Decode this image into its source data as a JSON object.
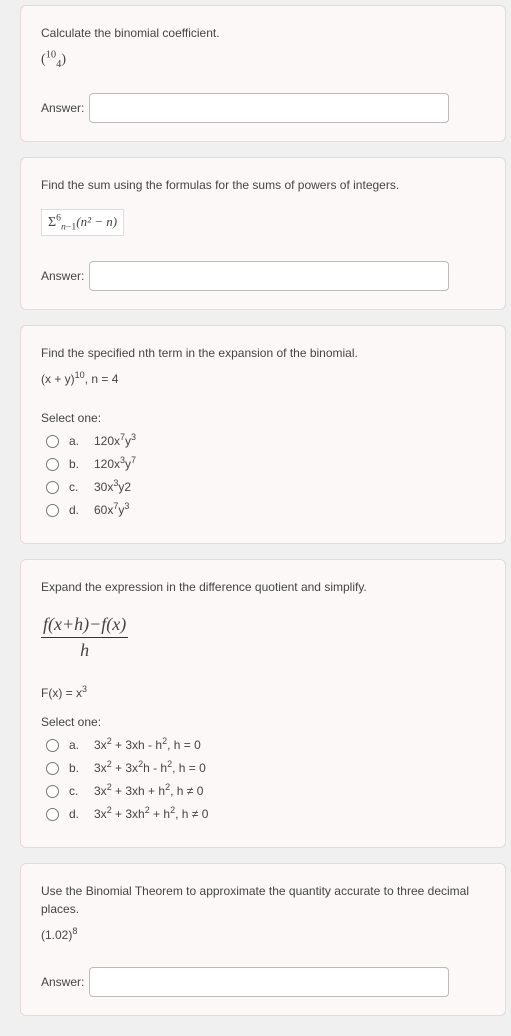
{
  "q1": {
    "prompt": "Calculate the binomial coefficient.",
    "expr_base_open": "(",
    "expr_sup": "10",
    "expr_sub": "4",
    "expr_close": ")",
    "answer_label": "Answer:"
  },
  "q2": {
    "prompt": "Find the sum using the formulas for the sums of powers of integers.",
    "sigma": "Σ",
    "sigma_top": "6",
    "sigma_bottom_pre": "n",
    "sigma_bottom_post": "−1",
    "body": "(n² − n)",
    "answer_label": "Answer:"
  },
  "q3": {
    "prompt": "Find the specified nth term in the expansion of the binomial.",
    "expr_pre": "(x + y)",
    "expr_sup": "10",
    "expr_post": ", n = 4",
    "select_label": "Select one:",
    "opt_a_letter": "a.",
    "opt_a_pre": "120x",
    "opt_a_sup1": "7",
    "opt_a_mid": "y",
    "opt_a_sup2": "3",
    "opt_b_letter": "b.",
    "opt_b_pre": "120x",
    "opt_b_sup1": "3",
    "opt_b_mid": "y",
    "opt_b_sup2": "7",
    "opt_c_letter": "c.",
    "opt_c_pre": "30x",
    "opt_c_sup1": "3",
    "opt_c_mid": "y2",
    "opt_d_letter": "d.",
    "opt_d_pre": "60x",
    "opt_d_sup1": "7",
    "opt_d_mid": "y",
    "opt_d_sup2": "3"
  },
  "q4": {
    "prompt": "Expand the expression in the difference quotient and simplify.",
    "num": "f(x+h)−f(x)",
    "den": "h",
    "fx_pre": "F(x) = x",
    "fx_sup": "3",
    "select_label": "Select one:",
    "opt_a_letter": "a.",
    "opt_a_p1": "3x",
    "opt_a_s1": "2",
    "opt_a_p2": " + 3xh - h",
    "opt_a_s2": "2",
    "opt_a_p3": ", h = 0",
    "opt_b_letter": "b.",
    "opt_b_p1": "3x",
    "opt_b_s1": "2",
    "opt_b_p2": " + 3x",
    "opt_b_s2": "2",
    "opt_b_p3": "h - h",
    "opt_b_s3": "2",
    "opt_b_p4": ", h = 0",
    "opt_c_letter": "c.",
    "opt_c_p1": "3x",
    "opt_c_s1": "2",
    "opt_c_p2": " + 3xh + h",
    "opt_c_s2": "2",
    "opt_c_p3": ", h ≠ 0",
    "opt_d_letter": "d.",
    "opt_d_p1": "3x",
    "opt_d_s1": "2",
    "opt_d_p2": " + 3xh",
    "opt_d_s2": "2",
    "opt_d_p3": " + h",
    "opt_d_s3": "2",
    "opt_d_p4": ", h ≠ 0"
  },
  "q5": {
    "prompt": "Use the Binomial Theorem to approximate the quantity accurate to three decimal places.",
    "expr_pre": "(1.02)",
    "expr_sup": "8",
    "answer_label": "Answer:"
  }
}
